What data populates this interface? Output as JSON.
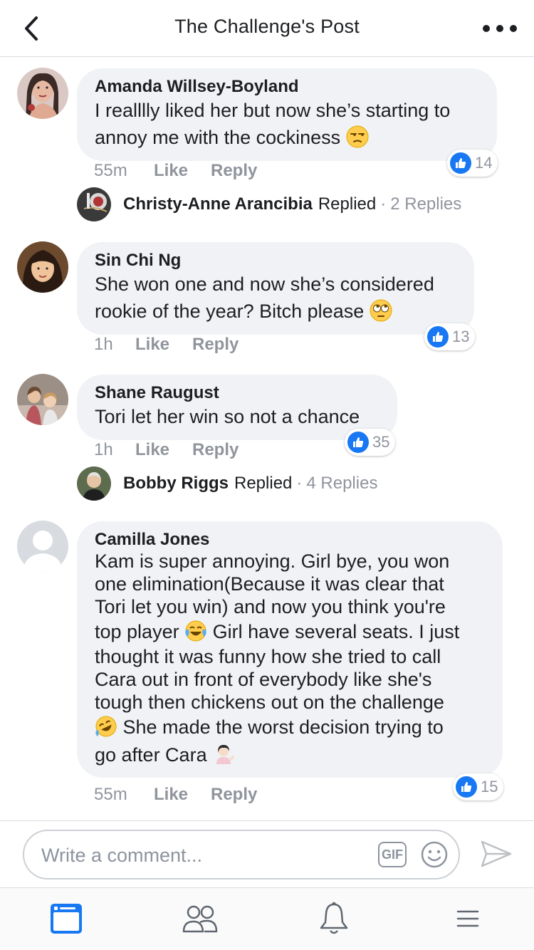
{
  "header": {
    "title": "The Challenge's Post"
  },
  "comments": [
    {
      "name": "Amanda Willsey-Boyland",
      "text_lines": [
        "I realllly liked her but now she’s starting to",
        "annoy me with the cockiness"
      ],
      "emoji": "unamused-face",
      "time": "55m",
      "like_label": "Like",
      "reply_label": "Reply",
      "reaction_count": "14",
      "replied": {
        "name": "Christy-Anne Arancibia",
        "verb": "Replied",
        "dot": "·",
        "count": "2 Replies"
      }
    },
    {
      "name": "Sin Chi Ng",
      "text_lines": [
        "She won one and now she’s considered",
        "rookie of the year? Bitch please"
      ],
      "emoji": "rolling-eyes-face",
      "time": "1h",
      "like_label": "Like",
      "reply_label": "Reply",
      "reaction_count": "13"
    },
    {
      "name": "Shane Raugust",
      "text_lines": [
        "Tori let her win so not a chance"
      ],
      "time": "1h",
      "like_label": "Like",
      "reply_label": "Reply",
      "reaction_count": "35",
      "replied": {
        "name": "Bobby Riggs",
        "verb": "Replied",
        "dot": "·",
        "count": "4 Replies"
      }
    },
    {
      "name": "Camilla Jones",
      "text_lines": [
        "Kam is super annoying. Girl bye, you won",
        "one elimination(Because it was clear that",
        "Tori let you win) and now you think you're",
        "top player",
        "Girl have several seats. I just",
        "thought it was funny how she tried to call",
        "Cara out in front of everybody like she's",
        "tough then chickens out on the challenge",
        "She made the worst decision trying to",
        "go after Cara"
      ],
      "emojis": [
        "face-with-tears-of-joy",
        "rolling-on-floor-laughing",
        "person-tipping-hand"
      ],
      "time": "55m",
      "like_label": "Like",
      "reply_label": "Reply",
      "reaction_count": "15"
    }
  ],
  "composer": {
    "placeholder": "Write a comment...",
    "gif_label": "GIF"
  },
  "icons": {
    "back": "chevron-left-icon",
    "more": "more-dots-icon",
    "like_reaction": "thumbs-up-icon",
    "emoji_button": "smiley-icon",
    "send": "send-icon",
    "tabs": [
      "news-feed-icon",
      "friends-icon",
      "notifications-bell-icon",
      "menu-icon"
    ]
  },
  "colors": {
    "accent": "#1877f2",
    "bubble": "#f0f2f5",
    "meta_text": "#90949c"
  }
}
